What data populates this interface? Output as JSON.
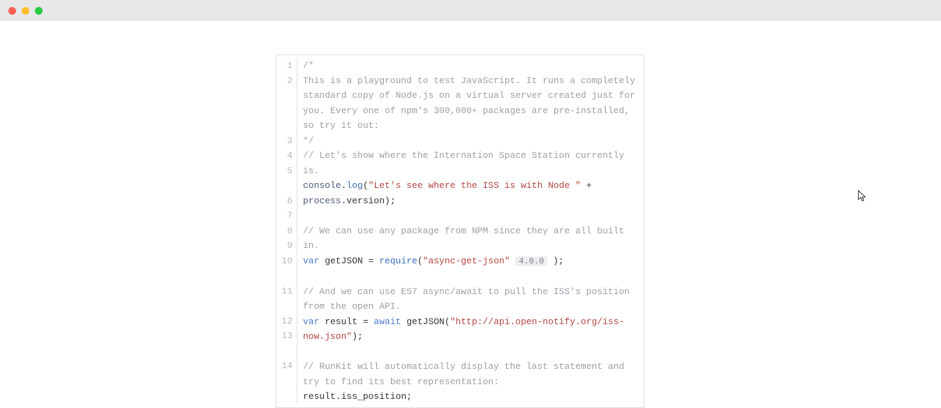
{
  "titlebar": {},
  "editor": {
    "gutter": [
      "1",
      "2",
      "",
      "",
      "",
      "3",
      "4",
      "5",
      "",
      "6",
      "7",
      "8",
      "9",
      "10",
      "",
      "11",
      "",
      "12",
      "13",
      "",
      "14"
    ],
    "lines": {
      "l1": "/*",
      "l2": "This is a playground to test JavaScript. It runs a completely standard copy of Node.js on a virtual server created just for you. Every one of npm's 300,000+ packages are pre-installed, so try it out:",
      "l3": "*/",
      "l4": "// Let's show where the Internation Space Station currently is.",
      "l5a": "console",
      "l5b": ".",
      "l5c": "log",
      "l5d": "(",
      "l5e": "\"Let's see where the ISS is with Node \"",
      "l5f": " + ",
      "l5g": "process",
      "l5h": ".",
      "l5i": "version",
      "l5j": ");",
      "l7": "// We can use any package from NPM since they are all built in.",
      "l8a": "var",
      "l8b": " getJSON = ",
      "l8c": "require",
      "l8d": "(",
      "l8e": "\"async-get-json\"",
      "l8f": "4.0.0",
      "l8g": ");",
      "l10": "// And we can use ES7 async/await to pull the ISS's position from the open API.",
      "l11a": "var",
      "l11b": " result = ",
      "l11c": "await",
      "l11d": " getJSON(",
      "l11e": "\"http://api.open-notify.org/iss-now.json\"",
      "l11f": ");",
      "l13": "// RunKit will automatically display the last statement and try to find its best representation:",
      "l14a": "result",
      "l14b": ".",
      "l14c": "iss_position",
      "l14d": ";"
    }
  }
}
